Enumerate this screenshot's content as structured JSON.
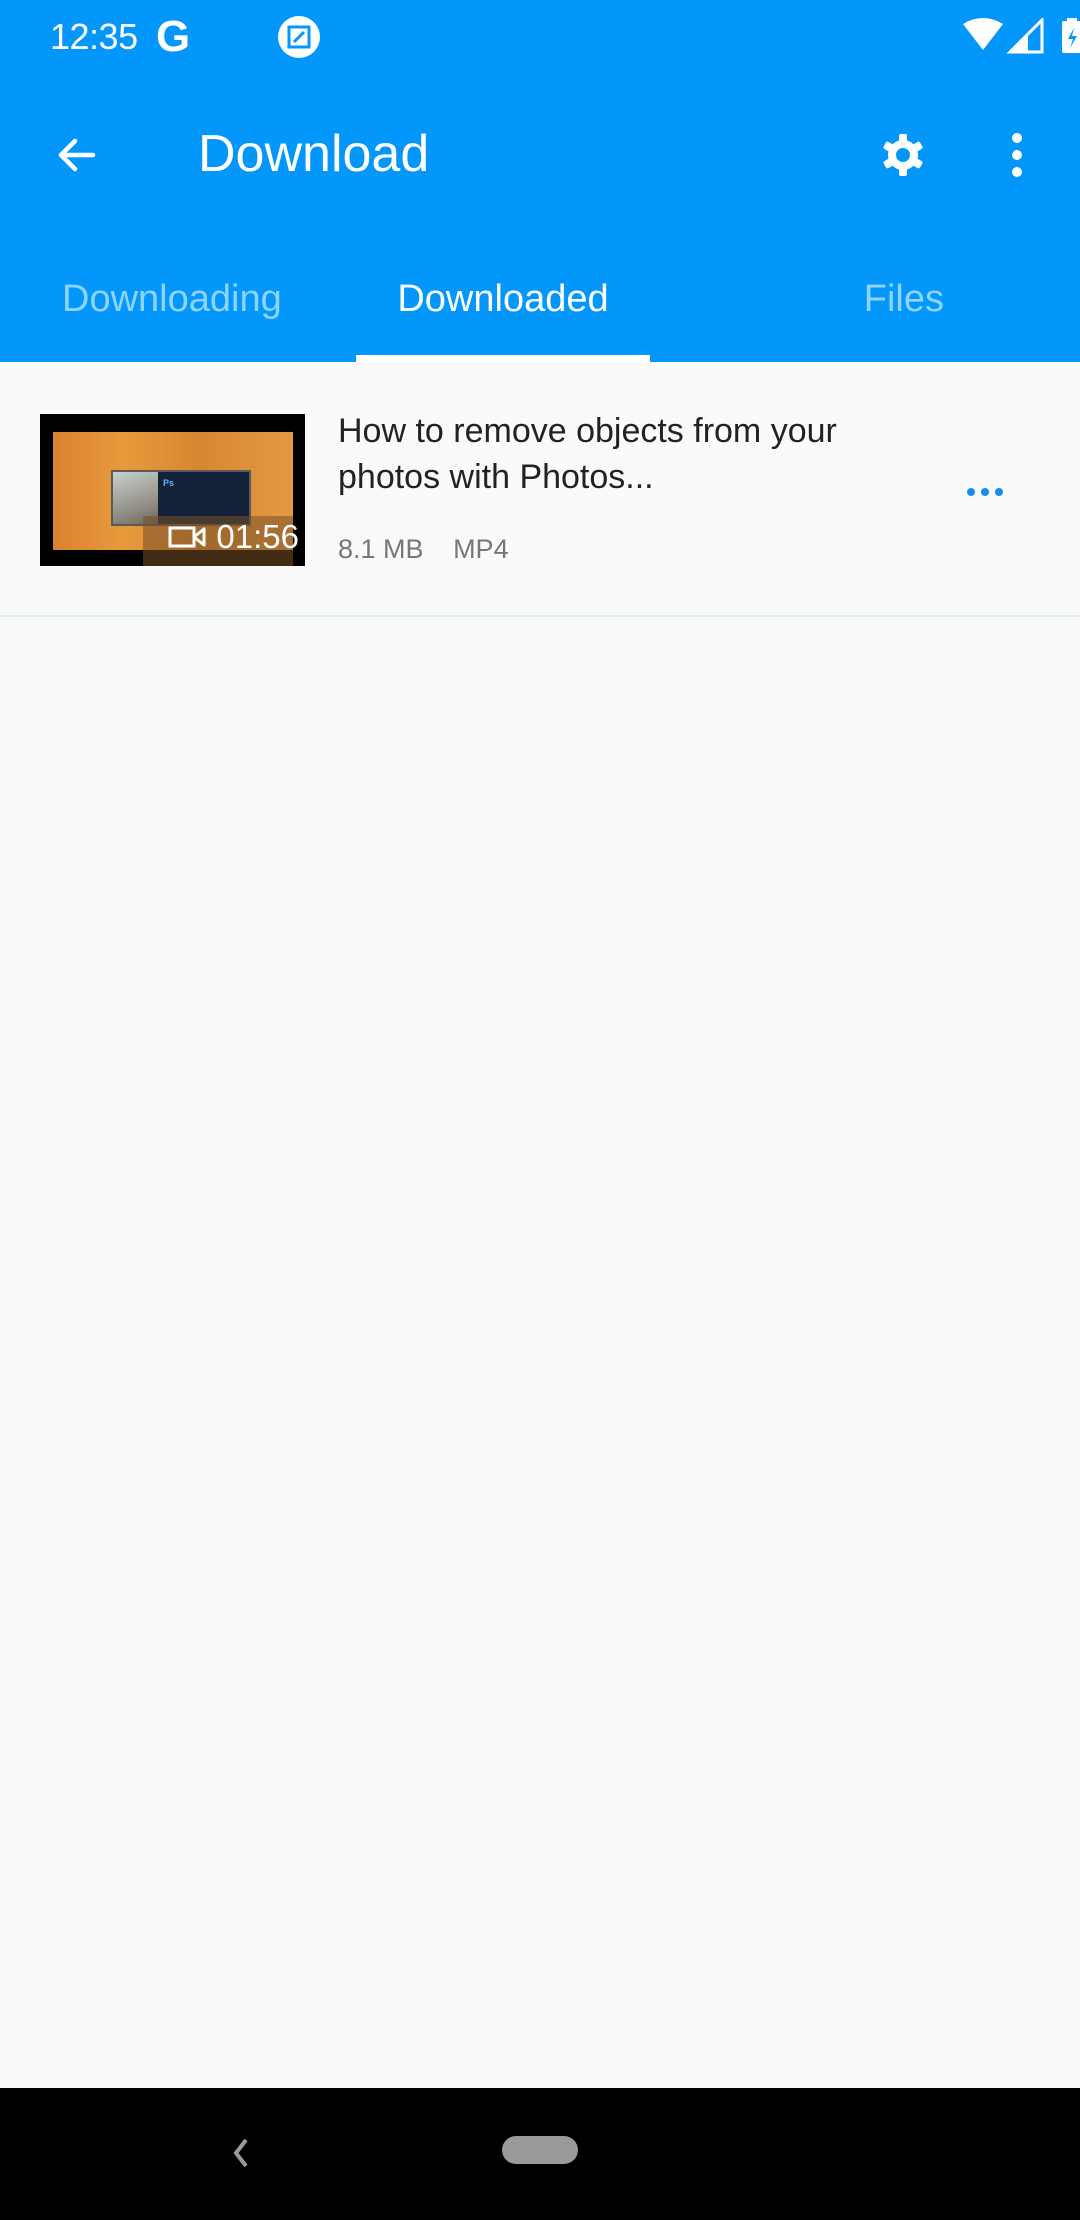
{
  "status_bar": {
    "time": "12:35",
    "google_glyph": "G",
    "icons": [
      "google-icon",
      "screenshot-edit-icon",
      "wifi-icon",
      "cellular-signal-icon",
      "battery-charging-icon"
    ]
  },
  "app_bar": {
    "title": "Download",
    "back_icon": "arrow-back-icon",
    "settings_icon": "gear-icon",
    "more_icon": "more-vert-icon"
  },
  "tabs": [
    {
      "label": "Downloading",
      "active": false
    },
    {
      "label": "Downloaded",
      "active": true
    },
    {
      "label": "Files",
      "active": false
    }
  ],
  "downloads": [
    {
      "title": "How to remove objects from your photos with Photos...",
      "duration": "01:56",
      "size": "8.1 MB",
      "format": "MP4",
      "thumbnail_ps_label": "Ps"
    }
  ],
  "colors": {
    "primary": "#0497fb",
    "tab_inactive": "#8fd3ff",
    "accent_dots": "#1a8ee6",
    "background": "#fafafa"
  },
  "nav_bar": {
    "back_icon": "nav-back-icon",
    "home_icon": "nav-home-pill-icon"
  }
}
